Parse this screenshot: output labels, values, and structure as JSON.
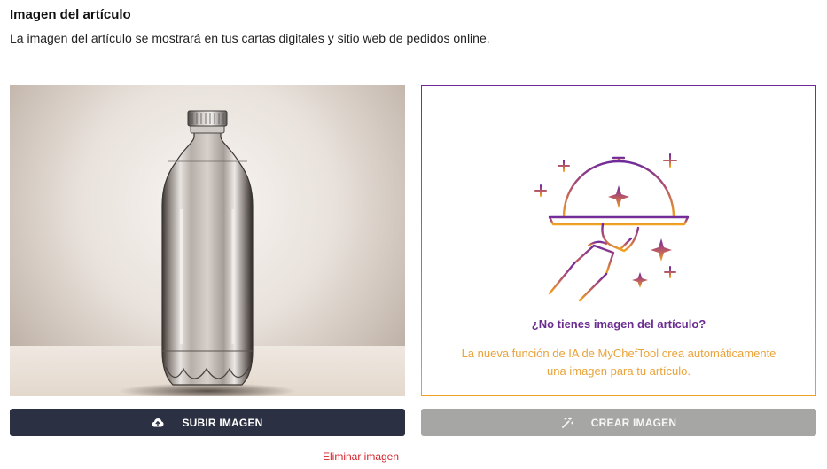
{
  "section": {
    "title": "Imagen del artículo",
    "subtitle": "La imagen del artículo se mostrará en tus cartas digitales y sitio web de pedidos online."
  },
  "photo": {
    "subject": "plastic water bottle"
  },
  "ai_panel": {
    "question": "¿No tienes imagen del artículo?",
    "description": "La nueva función de IA de MyChefTool crea automáticamente una imagen para tu artículo.",
    "illustration_icon": "serving-cloche-sparkles-icon",
    "colors": {
      "purple": "#6a2c91",
      "orange": "#f0a022"
    }
  },
  "buttons": {
    "upload_label": "SUBIR IMAGEN",
    "upload_icon": "cloud-upload-icon",
    "upload_color": "#2b3042",
    "create_label": "CREAR IMAGEN",
    "create_icon": "magic-wand-icon",
    "create_color": "#a6a6a4"
  },
  "remove_link": {
    "label": "Eliminar imagen",
    "color": "#d6232b"
  }
}
